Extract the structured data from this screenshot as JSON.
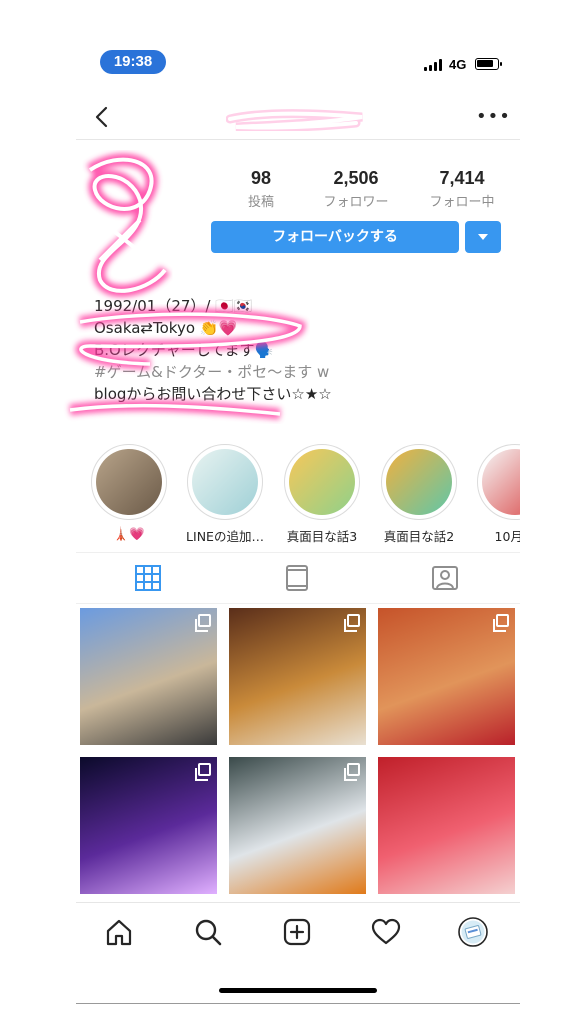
{
  "status": {
    "time": "19:38",
    "network": "4G"
  },
  "header": {
    "back_icon": "chevron-left-icon",
    "more_label": "•••"
  },
  "stats": [
    {
      "value": "98",
      "label": "投稿"
    },
    {
      "value": "2,506",
      "label": "フォロワー"
    },
    {
      "value": "7,414",
      "label": "フォロー中"
    }
  ],
  "actions": {
    "follow_back_label": "フォローバックする"
  },
  "bio": {
    "line1": "1992/01（27）/ 🇯🇵🇰🇷",
    "line2": "Osaka⇄Tokyo 👏💗",
    "line3": "B.Oレクチャーしてます🗣️",
    "line4": "#ゲーム&ドクター・ポセ〜ます w",
    "line5": "blogからお問い合わせ下さい☆★☆"
  },
  "highlights": [
    {
      "label": "🗼💗",
      "colors": [
        "#b8a48a",
        "#6b5a48"
      ]
    },
    {
      "label": "LINEの追加…",
      "colors": [
        "#e8f3f1",
        "#9fd0d6"
      ]
    },
    {
      "label": "真面目な話3",
      "colors": [
        "#f7c75a",
        "#8fd18a"
      ]
    },
    {
      "label": "真面目な話2",
      "colors": [
        "#f0b040",
        "#5fc7a8"
      ]
    },
    {
      "label": "10月度",
      "colors": [
        "#f6f6f6",
        "#d94a4a"
      ]
    }
  ],
  "tabs": [
    "grid-icon",
    "igtv-icon",
    "tagged-icon"
  ],
  "posts": [
    {
      "desc": "girl-walking-photo",
      "colors": [
        "#6b9be0",
        "#c9b79a",
        "#3a3a3a"
      ]
    },
    {
      "desc": "tempura-dish-photo",
      "colors": [
        "#5a2e1a",
        "#c98a3a",
        "#e9e0d2"
      ]
    },
    {
      "desc": "autumn-leaves-photo",
      "colors": [
        "#c6532a",
        "#e1945a",
        "#b9202a"
      ]
    },
    {
      "desc": "christmas-tree-photo",
      "colors": [
        "#0b0a2a",
        "#5b2a9a",
        "#e0b0ff"
      ]
    },
    {
      "desc": "sea-urchin-dish-photo",
      "colors": [
        "#3a4a4a",
        "#dfe4e8",
        "#e07a1a"
      ]
    },
    {
      "desc": "nail-art-photo",
      "colors": [
        "#c0202a",
        "#f06070",
        "#f4d0d0"
      ]
    }
  ],
  "bottom_nav": [
    "home-icon",
    "search-icon",
    "add-post-icon",
    "heart-icon",
    "profile-avatar"
  ]
}
